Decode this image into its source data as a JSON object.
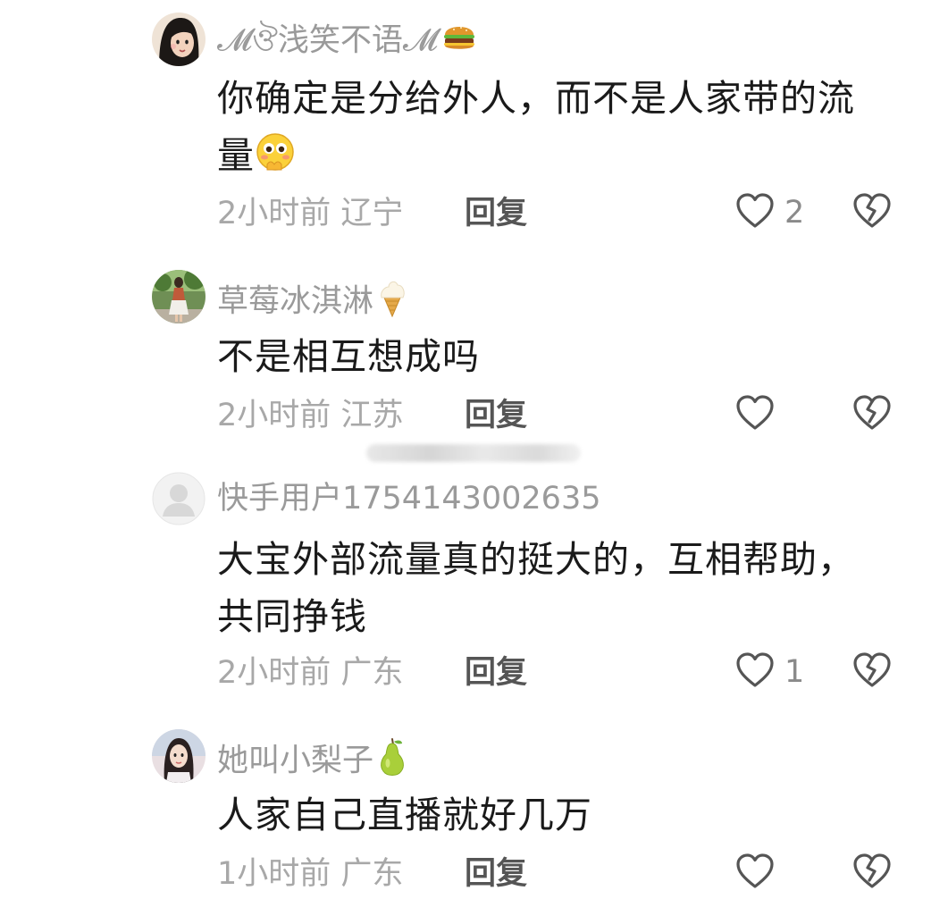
{
  "comments": [
    {
      "username": "𝓜ঔ浅笑不语𝓜",
      "username_badge": "burger-emoji",
      "text": "你确定是分给外人，而不是人家带的流量",
      "text_emoji": "shy-face-emoji",
      "time": "2小时前",
      "location": "辽宁",
      "reply_label": "回复",
      "likes": "2"
    },
    {
      "username": "草莓冰淇淋",
      "username_badge": "ice-cream-emoji",
      "text": "不是相互想成吗",
      "time": "2小时前",
      "location": "江苏",
      "reply_label": "回复",
      "likes": ""
    },
    {
      "username": "快手用户1754143002635",
      "text": "大宝外部流量真的挺大的，互相帮助，共同挣钱",
      "time": "2小时前",
      "location": "广东",
      "reply_label": "回复",
      "likes": "1"
    },
    {
      "username": "她叫小梨子",
      "username_badge": "pear-emoji",
      "text": "人家自己直播就好几万",
      "time": "1小时前",
      "location": "广东",
      "reply_label": "回复",
      "likes": ""
    }
  ],
  "icons": {
    "like": "heart-outline-icon",
    "dislike": "broken-heart-icon",
    "default_avatar": "default-avatar-icon"
  },
  "colors": {
    "username": "#9a9a9a",
    "text": "#1a1a1a",
    "meta": "#a8a8a8",
    "reply": "#555555",
    "icon": "#555555"
  }
}
